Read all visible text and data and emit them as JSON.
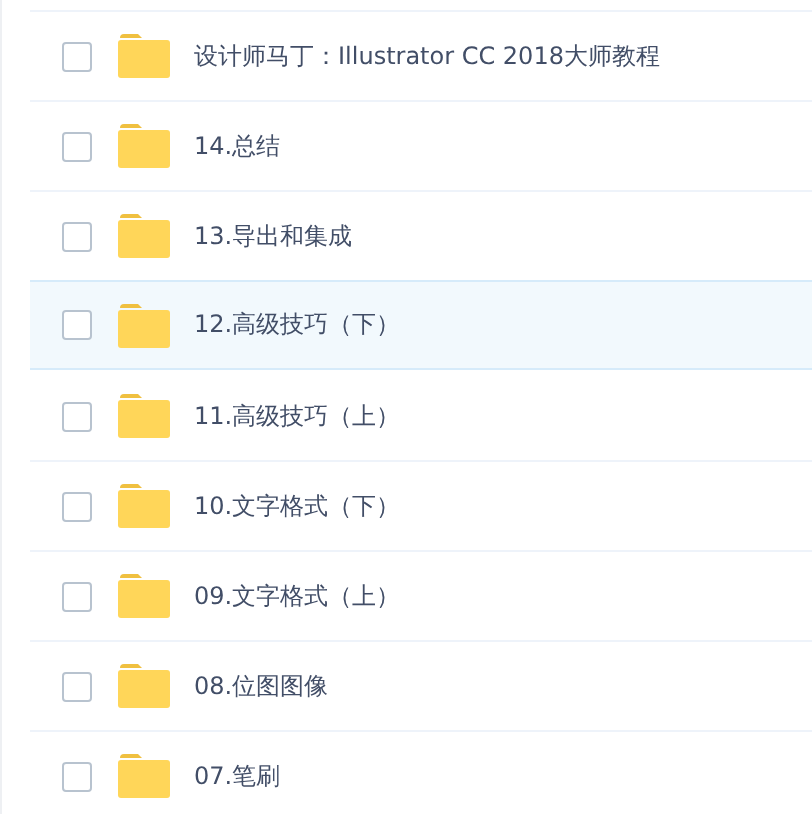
{
  "files": [
    {
      "name": "设计师马丁：Illustrator CC 2018大师教程",
      "checked": false,
      "highlighted": false
    },
    {
      "name": "14.总结",
      "checked": false,
      "highlighted": false
    },
    {
      "name": "13.导出和集成",
      "checked": false,
      "highlighted": false
    },
    {
      "name": "12.高级技巧（下）",
      "checked": false,
      "highlighted": true
    },
    {
      "name": "11.高级技巧（上）",
      "checked": false,
      "highlighted": false
    },
    {
      "name": "10.文字格式（下）",
      "checked": false,
      "highlighted": false
    },
    {
      "name": "09.文字格式（上）",
      "checked": false,
      "highlighted": false
    },
    {
      "name": "08.位图图像",
      "checked": false,
      "highlighted": false
    },
    {
      "name": "07.笔刷",
      "checked": false,
      "highlighted": false
    }
  ]
}
